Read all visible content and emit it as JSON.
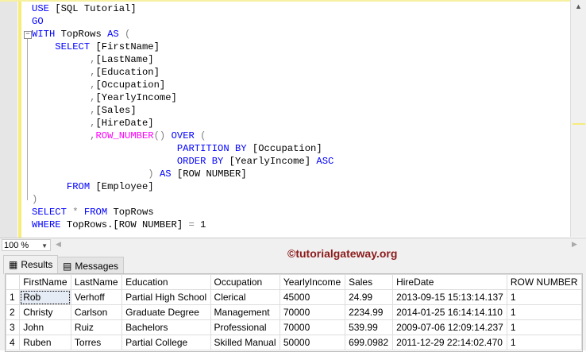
{
  "editor": {
    "lines": [
      [
        [
          "USE",
          "k"
        ],
        [
          " [SQL Tutorial]",
          "t"
        ]
      ],
      [
        [
          "GO",
          "k"
        ]
      ],
      [
        [
          "WITH",
          "k"
        ],
        [
          " TopRows ",
          "t"
        ],
        [
          "AS",
          "k"
        ],
        [
          " (",
          "g"
        ]
      ],
      [
        [
          "    ",
          "t"
        ],
        [
          "SELECT",
          "k"
        ],
        [
          " [FirstName]",
          "t"
        ]
      ],
      [
        [
          "          ",
          "t"
        ],
        [
          ",",
          "g"
        ],
        [
          "[LastName]",
          "t"
        ]
      ],
      [
        [
          "          ",
          "t"
        ],
        [
          ",",
          "g"
        ],
        [
          "[Education]",
          "t"
        ]
      ],
      [
        [
          "          ",
          "t"
        ],
        [
          ",",
          "g"
        ],
        [
          "[Occupation]",
          "t"
        ]
      ],
      [
        [
          "          ",
          "t"
        ],
        [
          ",",
          "g"
        ],
        [
          "[YearlyIncome]",
          "t"
        ]
      ],
      [
        [
          "          ",
          "t"
        ],
        [
          ",",
          "g"
        ],
        [
          "[Sales]",
          "t"
        ]
      ],
      [
        [
          "          ",
          "t"
        ],
        [
          ",",
          "g"
        ],
        [
          "[HireDate]",
          "t"
        ]
      ],
      [
        [
          "          ",
          "t"
        ],
        [
          ",",
          "g"
        ],
        [
          "ROW_NUMBER",
          "f"
        ],
        [
          "()",
          "g"
        ],
        [
          " ",
          "t"
        ],
        [
          "OVER",
          "k"
        ],
        [
          " (",
          "g"
        ]
      ],
      [
        [
          "                         ",
          "t"
        ],
        [
          "PARTITION BY",
          "k"
        ],
        [
          " [Occupation]",
          "t"
        ]
      ],
      [
        [
          "                         ",
          "t"
        ],
        [
          "ORDER BY",
          "k"
        ],
        [
          " [YearlyIncome] ",
          "t"
        ],
        [
          "ASC",
          "k"
        ]
      ],
      [
        [
          "                    ",
          "t"
        ],
        [
          ")",
          "g"
        ],
        [
          " ",
          "t"
        ],
        [
          "AS",
          "k"
        ],
        [
          " [ROW NUMBER]",
          "t"
        ]
      ],
      [
        [
          "      ",
          "t"
        ],
        [
          "FROM",
          "k"
        ],
        [
          " [Employee]",
          "t"
        ]
      ],
      [
        [
          ")",
          "g"
        ]
      ],
      [
        [
          "SELECT",
          "k"
        ],
        [
          " ",
          "t"
        ],
        [
          "*",
          "g"
        ],
        [
          " ",
          "t"
        ],
        [
          "FROM",
          "k"
        ],
        [
          " TopRows",
          "t"
        ]
      ],
      [
        [
          "WHERE",
          "k"
        ],
        [
          " TopRows.[ROW NUMBER] ",
          "t"
        ],
        [
          "=",
          "g"
        ],
        [
          " 1",
          "t"
        ]
      ]
    ]
  },
  "zoom": {
    "value": "100 %"
  },
  "tabs": {
    "results": "Results",
    "messages": "Messages"
  },
  "watermark": "©tutorialgateway.org",
  "grid": {
    "columns": [
      "",
      "FirstName",
      "LastName",
      "Education",
      "Occupation",
      "YearlyIncome",
      "Sales",
      "HireDate",
      "ROW NUMBER"
    ],
    "rows": [
      [
        "1",
        "Rob",
        "Verhoff",
        "Partial High School",
        "Clerical",
        "45000",
        "24.99",
        "2013-09-15 15:13:14.137",
        "1"
      ],
      [
        "2",
        "Christy",
        "Carlson",
        "Graduate Degree",
        "Management",
        "70000",
        "2234.99",
        "2014-01-25 16:14:14.110",
        "1"
      ],
      [
        "3",
        "John",
        "Ruiz",
        "Bachelors",
        "Professional",
        "70000",
        "539.99",
        "2009-07-06 12:09:14.237",
        "1"
      ],
      [
        "4",
        "Ruben",
        "Torres",
        "Partial College",
        "Skilled Manual",
        "50000",
        "699.0982",
        "2011-12-29 22:14:02.470",
        "1"
      ]
    ]
  }
}
